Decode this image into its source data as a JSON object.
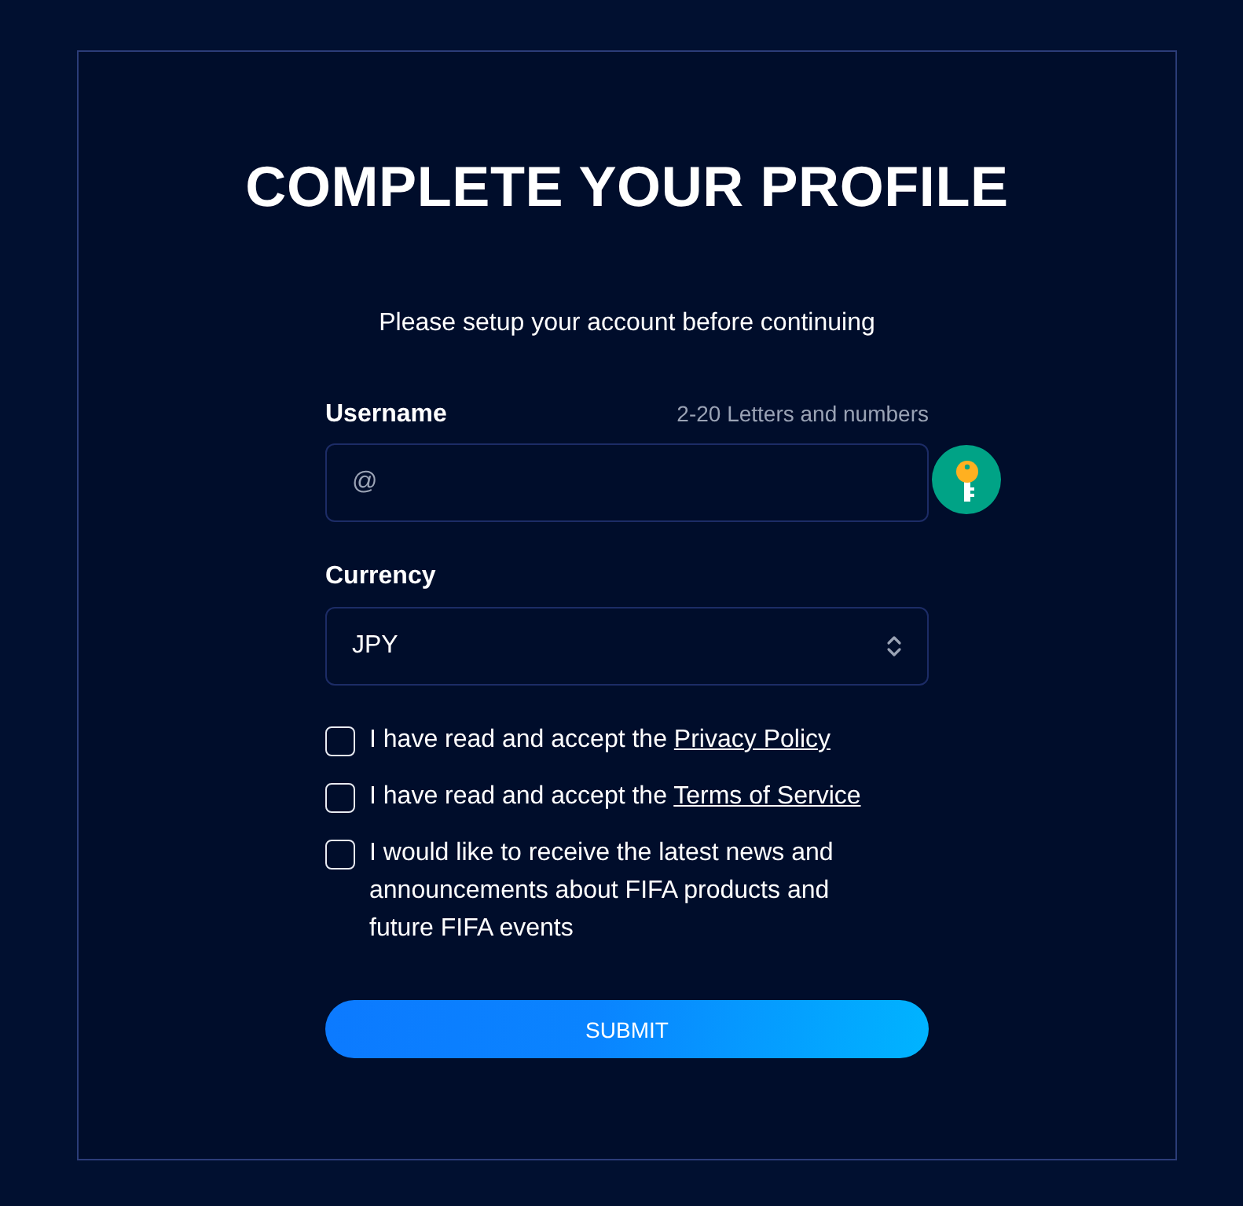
{
  "title": "COMPLETE YOUR PROFILE",
  "subtitle": "Please setup your account before continuing",
  "username": {
    "label": "Username",
    "hint": "2-20 Letters and numbers",
    "placeholder": "@"
  },
  "currency": {
    "label": "Currency",
    "value": "JPY"
  },
  "checkboxes": [
    {
      "text": "I have read and accept the",
      "link": "Privacy Policy",
      "checked": false
    },
    {
      "text": "I have read and accept the",
      "link": "Terms of Service",
      "checked": false
    },
    {
      "text": "I would like to receive the latest news and announcements about FIFA products and future FIFA events",
      "checked": false
    }
  ],
  "submit": "SUBMIT"
}
